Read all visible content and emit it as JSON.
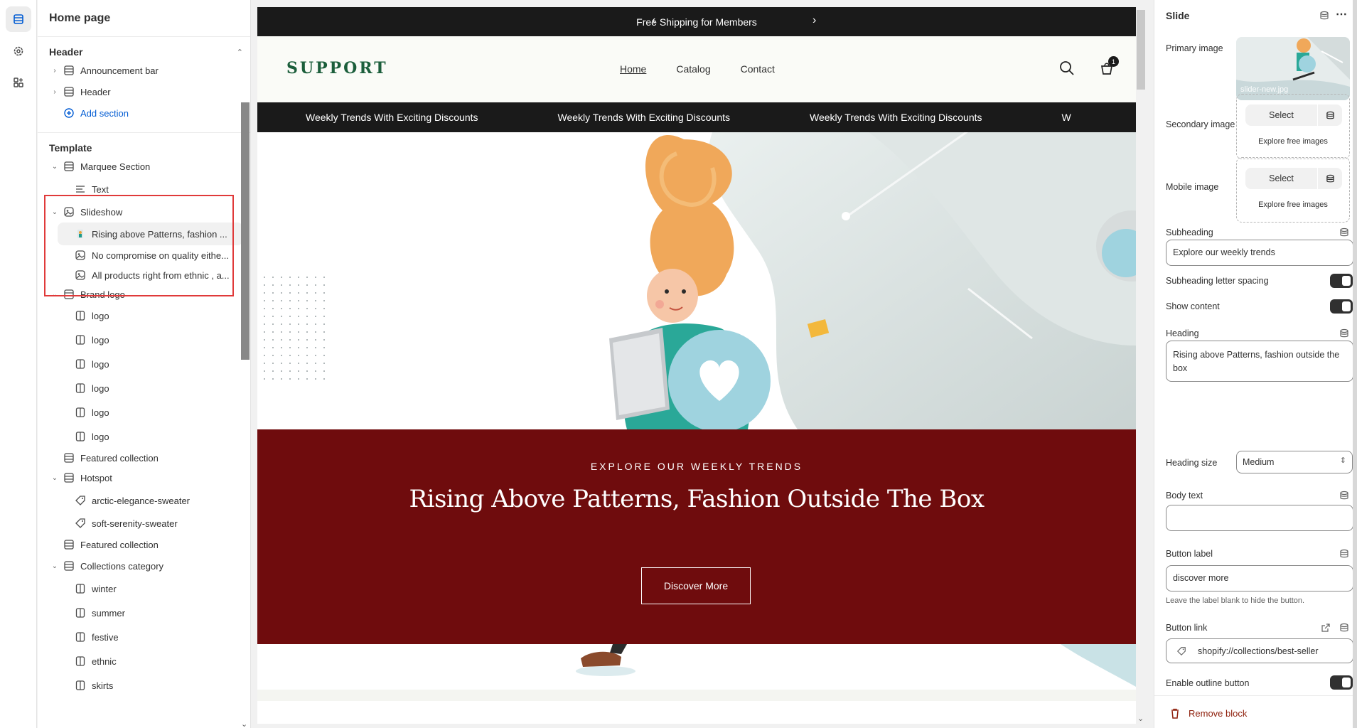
{
  "left_panel": {
    "title": "Home page",
    "header_group": "Header",
    "header_items": [
      "Announcement bar",
      "Header"
    ],
    "add_section": "Add section",
    "template_group": "Template",
    "marquee_section": "Marquee Section",
    "marquee_text": "Text",
    "slideshow": "Slideshow",
    "slides": [
      "Rising above Patterns, fashion ...",
      "No compromise on quality eithe...",
      "All products right from ethnic , a..."
    ],
    "brand_logo": "Brand logo",
    "logos": [
      "logo",
      "logo",
      "logo",
      "logo",
      "logo",
      "logo"
    ],
    "featured_collection_1": "Featured collection",
    "hotspot": "Hotspot",
    "hotspot_items": [
      "arctic-elegance-sweater",
      "soft-serenity-sweater"
    ],
    "featured_collection_2": "Featured collection",
    "collections_category": "Collections category",
    "categories": [
      "winter",
      "summer",
      "festive",
      "ethnic",
      "skirts"
    ]
  },
  "preview": {
    "announcement": "Free Shipping for Members",
    "logo": "SUPPORT",
    "nav": [
      "Home",
      "Catalog",
      "Contact"
    ],
    "cart_count": "1",
    "marquee": [
      "Weekly Trends With Exciting Discounts",
      "Weekly Trends With Exciting Discounts",
      "Weekly Trends With Exciting Discounts",
      "W"
    ],
    "subheading": "EXPLORE OUR WEEKLY TRENDS",
    "heading": "Rising Above Patterns, Fashion Outside The Box",
    "button": "Discover More"
  },
  "right_panel": {
    "title": "Slide",
    "primary_image_label": "Primary image",
    "primary_image_file": "slider-new.jpg",
    "secondary_image_label": "Secondary image",
    "mobile_image_label": "Mobile image",
    "select": "Select",
    "explore": "Explore free images",
    "subheading_label": "Subheading",
    "subheading_value": "Explore our weekly trends",
    "subheading_spacing_label": "Subheading letter spacing",
    "show_content_label": "Show content",
    "heading_label": "Heading",
    "heading_value": "Rising above Patterns, fashion outside the box",
    "heading_size_label": "Heading size",
    "heading_size_value": "Medium",
    "body_text_label": "Body text",
    "body_text_value": "",
    "button_label_label": "Button label",
    "button_label_value": "discover more",
    "button_label_hint": "Leave the label blank to hide the button.",
    "button_link_label": "Button link",
    "button_link_value": "shopify://collections/best-seller",
    "outline_label": "Enable outline button",
    "remove": "Remove block"
  }
}
